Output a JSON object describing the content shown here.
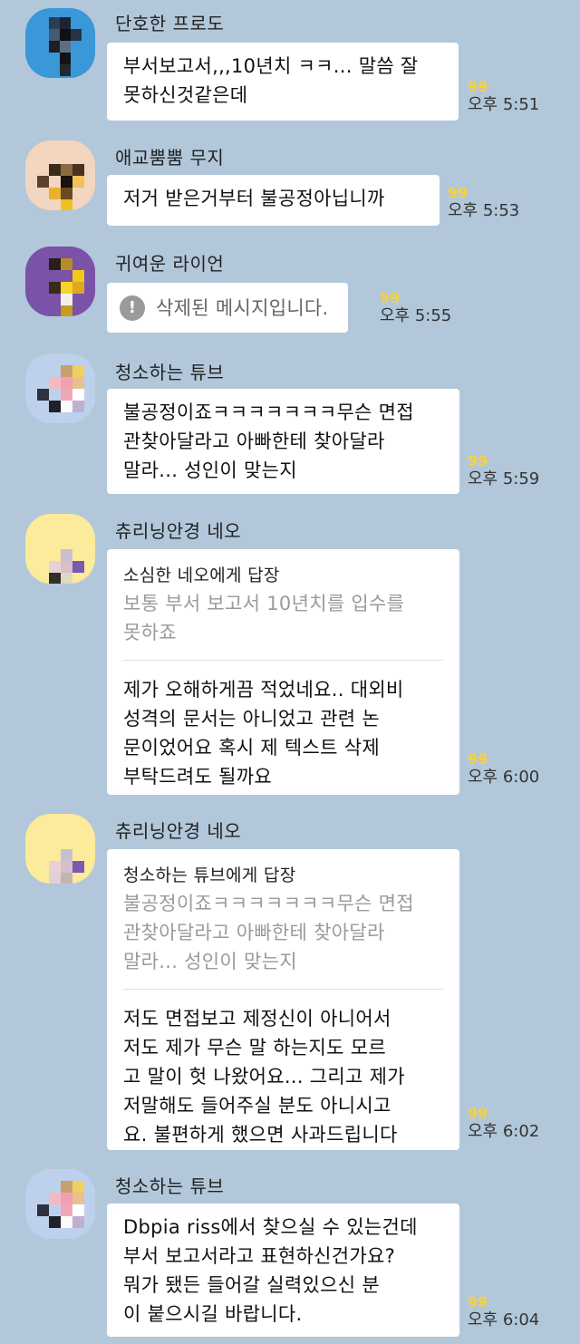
{
  "messages": [
    {
      "sender": "단호한 프로도",
      "text": [
        "부서보고서,,,10년치 ㅋㅋ... 말씀 잘",
        "못하신것같은데"
      ],
      "reads": "99",
      "time": "오후 5:51"
    },
    {
      "sender": "애교뿜뿜 무지",
      "text": [
        "저거 받은거부터 불공정아닙니까"
      ],
      "reads": "99",
      "time": "오후 5:53"
    },
    {
      "sender": "귀여운 라이언",
      "deleted_text": "삭제된 메시지입니다.",
      "reads": "99",
      "time": "오후 5:55"
    },
    {
      "sender": "청소하는 튜브",
      "text": [
        "불공정이죠ㅋㅋㅋㅋㅋㅋㅋ무슨 면접",
        "관찾아달라고 아빠한테 찾아달라",
        "말라... 성인이 맞는지"
      ],
      "reads": "99",
      "time": "오후 5:59"
    },
    {
      "sender": "츄리닝안경 네오",
      "reply_to": "소심한 네오에게 답장",
      "quote": [
        "보통 부서 보고서 10년치를 입수를",
        "못하죠"
      ],
      "text": [
        "제가 오해하게끔 적었네요.. 대외비",
        "성격의 문서는 아니었고 관련 논",
        "문이었어요 혹시 제 텍스트 삭제",
        "부탁드려도 될까요"
      ],
      "reads": "99",
      "time": "오후 6:00"
    },
    {
      "sender": "츄리닝안경 네오",
      "reply_to": "청소하는 튜브에게 답장",
      "quote": [
        "불공정이죠ㅋㅋㅋㅋㅋㅋㅋ무슨 면접",
        "관찾아달라고 아빠한테 찾아달라",
        "말라... 성인이 맞는지"
      ],
      "text": [
        "저도 면접보고 제정신이 아니어서",
        "저도 제가 무슨 말 하는지도 모르",
        "고 말이 헛 나왔어요... 그리고 제가",
        "저말해도 들어주실 분도 아니시고",
        "요. 불편하게 했으면 사과드립니다"
      ],
      "reads": "99",
      "time": "오후 6:02"
    },
    {
      "sender": "청소하는 튜브",
      "text": [
        "Dbpia riss에서 찾으실 수 있는건데",
        "부서 보고서라고 표현하신건가요?",
        "뭐가 됐든 들어갈 실력있으신 분",
        "이 붙으시길 바랍니다."
      ],
      "reads": "99",
      "time": "오후 6:04"
    }
  ],
  "colors": {
    "background": "#b2c7da",
    "read_count": "#f5d142",
    "bubble": "#ffffff"
  },
  "icons": {
    "deleted": "exclamation-circle-icon"
  }
}
